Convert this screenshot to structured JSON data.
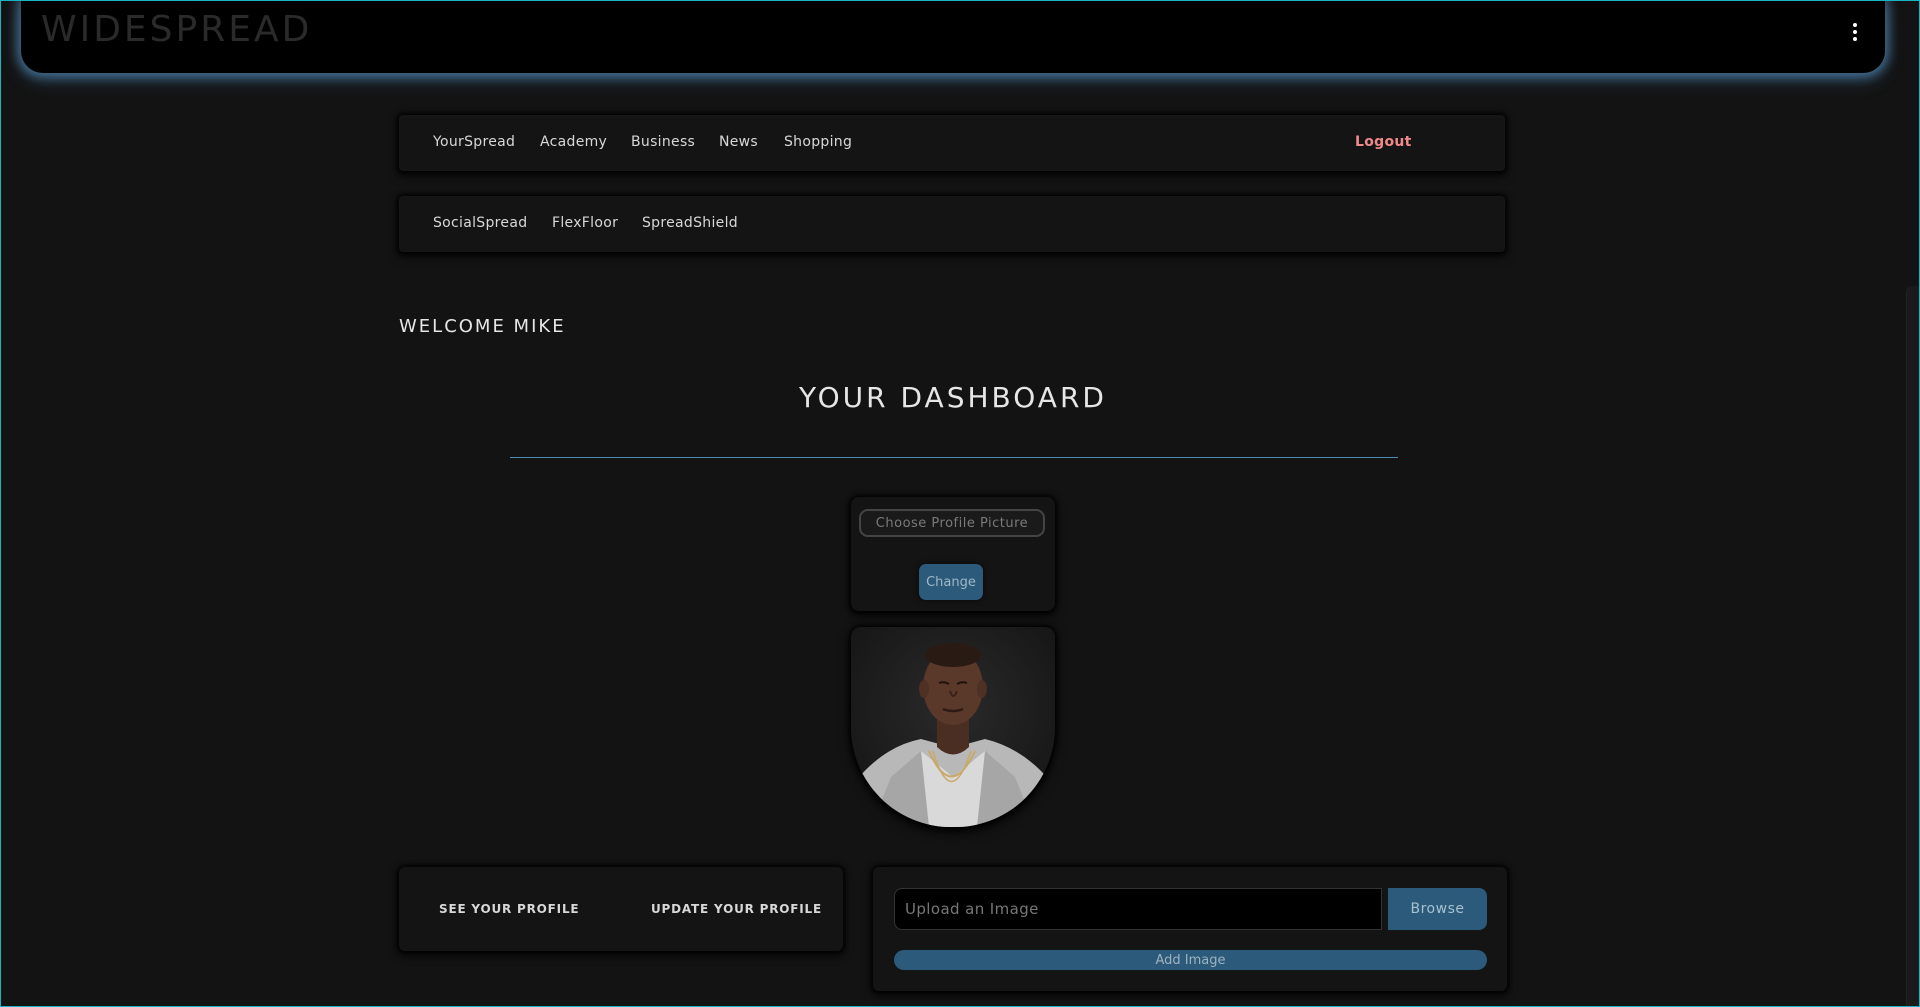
{
  "header": {
    "brand": "WIDESPREAD",
    "menu_icon": "kebab-menu-icon"
  },
  "nav_primary": {
    "items": [
      "YourSpread",
      "Academy",
      "Business",
      "News",
      "Shopping"
    ],
    "logout_label": "Logout",
    "logout_color": "#f08a8a"
  },
  "nav_secondary": {
    "items": [
      "SocialSpread",
      "FlexFloor",
      "SpreadShield"
    ]
  },
  "welcome_text": "WELCOME MIKE",
  "dashboard_title": "YOUR DASHBOARD",
  "profile_picture": {
    "choose_label": "Choose Profile Picture",
    "change_label": "Change",
    "avatar_alt": "profile-photo"
  },
  "profile_links": {
    "see_label": "SEE YOUR PROFILE",
    "update_label": "UPDATE YOUR PROFILE"
  },
  "upload": {
    "placeholder": "Upload an Image",
    "browse_label": "Browse",
    "add_label": "Add Image"
  },
  "colors": {
    "accent": "#2b5a7b",
    "border": "#19b4c3",
    "background": "#131313"
  }
}
